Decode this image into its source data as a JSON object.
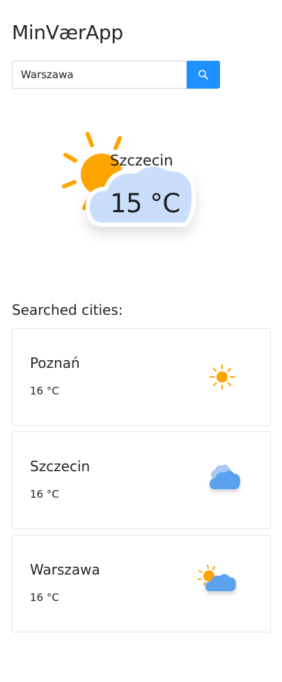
{
  "app": {
    "title": "MinVærApp"
  },
  "search": {
    "value": "Warszawa",
    "button_icon": "search-icon"
  },
  "current": {
    "city": "Szczecin",
    "temperature": "15 °C",
    "icon": "partly-cloudy-icon"
  },
  "searched": {
    "title": "Searched cities:",
    "cities": [
      {
        "name": "Poznań",
        "temperature": "16 °C",
        "icon": "sun-icon"
      },
      {
        "name": "Szczecin",
        "temperature": "16 °C",
        "icon": "cloudy-icon"
      },
      {
        "name": "Warszawa",
        "temperature": "16 °C",
        "icon": "partly-cloudy-icon"
      }
    ]
  },
  "colors": {
    "accent": "#1e90ff",
    "sun": "#ffa500",
    "cloud_light": "#c8defb",
    "cloud_blue": "#5aa2ee"
  }
}
